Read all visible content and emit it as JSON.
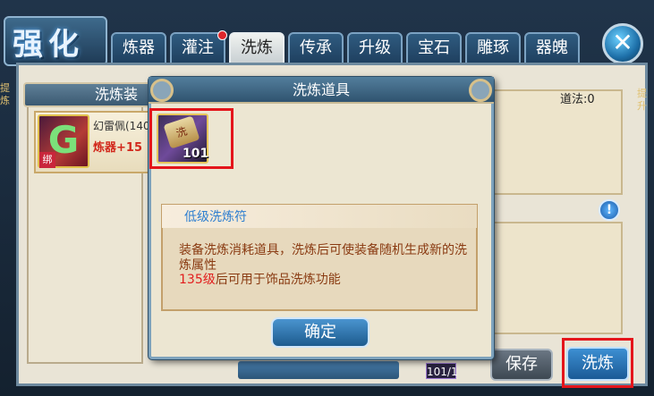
{
  "header": {
    "title": "强化"
  },
  "tabs": [
    {
      "label": "炼器",
      "active": false,
      "has_notice": false
    },
    {
      "label": "灌注",
      "active": false,
      "has_notice": true
    },
    {
      "label": "洗炼",
      "active": true,
      "has_notice": false
    },
    {
      "label": "传承",
      "active": false,
      "has_notice": false
    },
    {
      "label": "升级",
      "active": false,
      "has_notice": false
    },
    {
      "label": "宝石",
      "active": false,
      "has_notice": false
    },
    {
      "label": "雕琢",
      "active": false,
      "has_notice": false
    },
    {
      "label": "器魄",
      "active": false,
      "has_notice": false
    }
  ],
  "close_icon": "close-icon",
  "left_panel": {
    "header_text": "洗炼装",
    "item": {
      "name": "幻雷佩(140",
      "level_text": "炼器+15",
      "bound_tag": "绑",
      "icon": "jade-pendant-icon"
    }
  },
  "right_panel": {
    "daofa_label": "道法:0"
  },
  "buttons": {
    "save": "保存",
    "refine": "洗炼",
    "counter": "101/1"
  },
  "side_text": {
    "left": "提\n炼",
    "right": "提\n升"
  },
  "modal": {
    "title": "洗炼道具",
    "slot": {
      "count": "101",
      "glyph": "洗",
      "icon": "refine-scroll-icon"
    },
    "desc_title": "低级洗炼符",
    "desc_body": "装备洗炼消耗道具，洗炼后可使装备随机生成新的洗炼属性",
    "desc_level_prefix": "135级",
    "desc_level_suffix": "后可用于饰品洗炼功能",
    "confirm": "确定"
  },
  "colors": {
    "accent_red": "#e4151b",
    "tab_active_bg": "#e9eef0",
    "button_blue": "#1d5b8e",
    "desc_title_blue": "#2f7fd0"
  }
}
